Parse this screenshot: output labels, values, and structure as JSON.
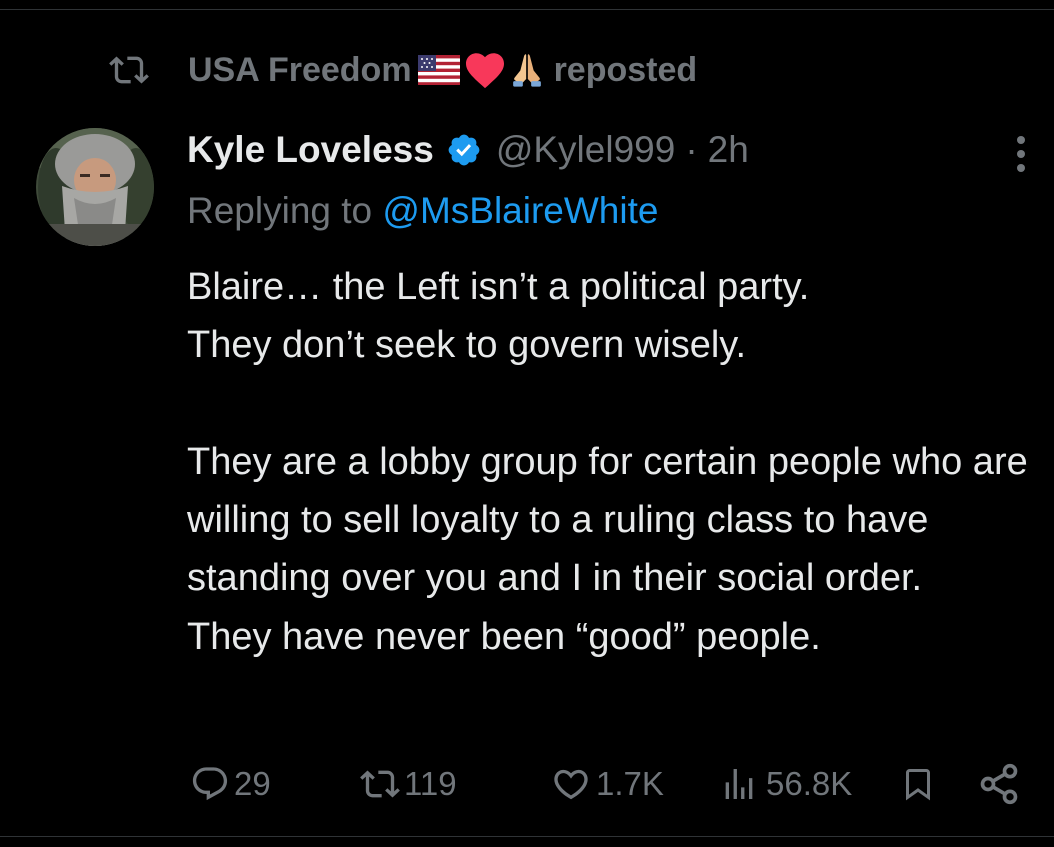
{
  "repost": {
    "icon": "repost-icon",
    "name": "USA Freedom",
    "emojis": [
      "us-flag-icon",
      "red-heart-icon",
      "folded-hands-icon"
    ],
    "text": "reposted"
  },
  "author": {
    "name": "Kyle Loveless",
    "handle": "@Kylel999",
    "separator": "·",
    "time": "2h",
    "verified_color": "#1d9bf0"
  },
  "reply": {
    "prefix": "Replying to",
    "mention": "@MsBlaireWhite"
  },
  "tweet": {
    "text": "Blaire… the Left isn’t a political party.\nThey don’t seek to govern wisely.\n\nThey are a lobby group for certain people who are willing to sell loyalty to a ruling class to have standing over you and I in their social order.   They have never been “good” people."
  },
  "actions": {
    "replies": "29",
    "reposts": "119",
    "likes": "1.7K",
    "views": "56.8K",
    "icons": [
      "reply-icon",
      "repost-icon",
      "like-icon",
      "views-icon",
      "bookmark-icon",
      "share-icon"
    ]
  },
  "colors": {
    "background": "#000000",
    "text": "#e7e9ea",
    "muted": "#71767b",
    "accent": "#1d9bf0"
  }
}
